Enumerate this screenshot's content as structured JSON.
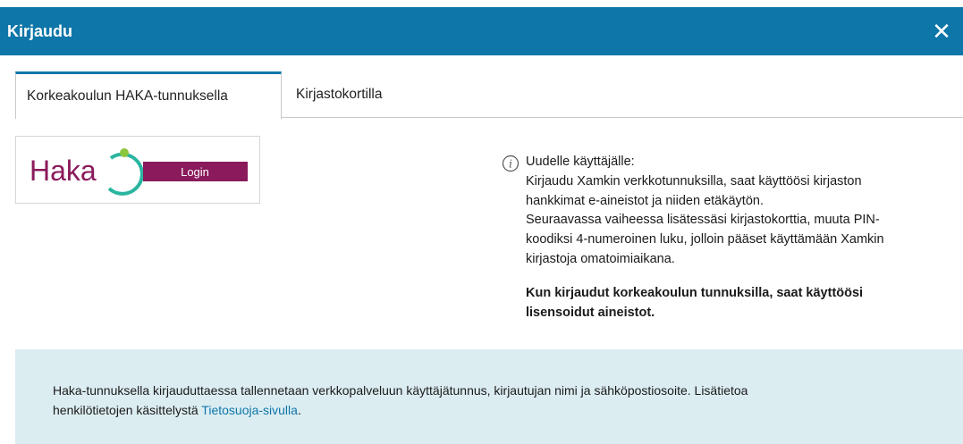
{
  "dialog": {
    "title": "Kirjaudu",
    "close_label": "✕"
  },
  "tabs": [
    {
      "label": "Korkeakoulun HAKA-tunnuksella",
      "active": true
    },
    {
      "label": "Kirjastokortilla",
      "active": false
    }
  ],
  "haka": {
    "logo_text": "Haka",
    "button_label": "Login",
    "brand_color": "#8a1a5b",
    "arc_color": "#2ab5a0",
    "dot_color": "#8cc63f"
  },
  "info": {
    "heading": "Uudelle käyttäjälle:",
    "line1": "Kirjaudu Xamkin verkkotunnuksilla, saat käyttöösi kirjaston",
    "line2": "hankkimat e-aineistot ja niiden etäkäytön.",
    "line3": "Seuraavassa vaiheessa lisätessäsi kirjastokorttia, muuta PIN-",
    "line4": "koodiksi 4-numeroinen luku, jolloin pääset käyttämään Xamkin",
    "line5": "kirjastoja omatoimiaikana.",
    "bold_line1": "Kun kirjaudut korkeakoulun tunnuksilla, saat käyttöösi",
    "bold_line2": "lisensoidut aineistot."
  },
  "notice": {
    "text_line1": "Haka-tunnuksella kirjauduttaessa tallennetaan verkkopalveluun käyttäjätunnus, kirjautujan nimi ja sähköpostiosoite. Lisätietoa",
    "text_line2_prefix": "henkilötietojen käsittelystä ",
    "link_label": "Tietosuoja-sivulla",
    "text_line2_suffix": "."
  },
  "colors": {
    "header_bg": "#0e76a8",
    "notice_bg": "#dcedf2",
    "link": "#0e76a8"
  }
}
